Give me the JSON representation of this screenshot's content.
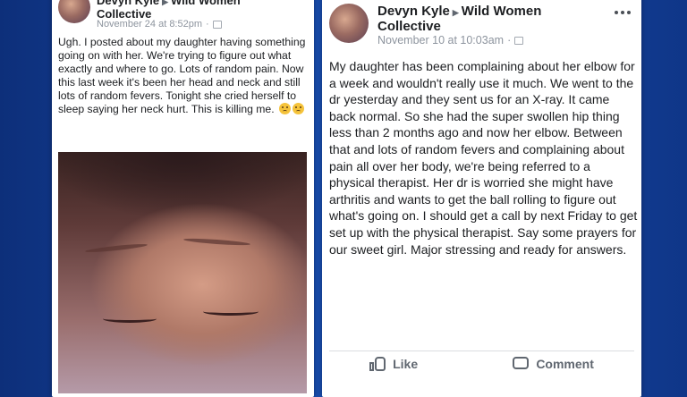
{
  "left_post": {
    "author": "Devyn Kyle",
    "group": "Wild Women Collective",
    "timestamp": "November 24 at 8:52pm",
    "body": "Ugh. I posted about my daughter having something going on with her. We're trying to figure out what exactly and where to go. Lots of random pain. Now this last week it's been her head and neck and still lots of random fevers. Tonight she cried herself to sleep saying her neck hurt. This is killing me."
  },
  "right_post": {
    "author": "Devyn Kyle",
    "group": "Wild Women Collective",
    "timestamp": "November 10 at 10:03am",
    "body": "My daughter has been complaining about her elbow for a week and wouldn't really use it much. We went to the dr yesterday and they sent us for an X-ray. It came back normal. So she had the super swollen hip thing less than 2 months ago and now her elbow. Between that and lots of random fevers and complaining about pain all over her body, we're being referred to a physical therapist. Her dr is worried she might have arthritis and wants to get the ball rolling to figure out what's going on. I should get a call by next Friday to get set up with the physical therapist. Say some prayers for our sweet girl. Major stressing and ready for answers.",
    "actions": {
      "like": "Like",
      "comment": "Comment"
    }
  },
  "icons": [
    "avatar",
    "arrow-right-icon",
    "globe-icon",
    "more-options-icon",
    "crying-emoji-icon",
    "like-icon",
    "comment-icon"
  ],
  "colors": {
    "background": "#1a4fb0",
    "text": "#1c1e21",
    "meta": "#8d949e",
    "action": "#606770"
  }
}
